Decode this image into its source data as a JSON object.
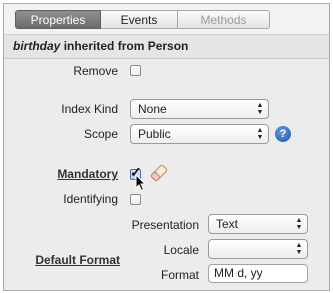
{
  "tabs": [
    {
      "label": "Properties",
      "state": "active"
    },
    {
      "label": "Events",
      "state": "normal"
    },
    {
      "label": "Methods",
      "state": "disabled"
    }
  ],
  "header": {
    "name": "birthday",
    "suffix": "inherited from Person"
  },
  "fields": {
    "remove": {
      "label": "Remove",
      "checked": false
    },
    "index_kind": {
      "label": "Index Kind",
      "value": "None"
    },
    "scope": {
      "label": "Scope",
      "value": "Public"
    },
    "mandatory": {
      "label": "Mandatory",
      "checked": true
    },
    "identifying": {
      "label": "Identifying",
      "checked": false
    },
    "default_format": {
      "label": "Default Format"
    },
    "presentation": {
      "label": "Presentation",
      "value": "Text"
    },
    "locale": {
      "label": "Locale",
      "value": ""
    },
    "format": {
      "label": "Format",
      "value": "MM d, yy"
    }
  },
  "icons": {
    "help": "help-icon",
    "eraser": "eraser-icon",
    "cursor": "pointer-cursor"
  },
  "help_glyph": "?",
  "colors": {
    "active_tab": "#7a7a7a",
    "help_blue": "#2a63b5"
  }
}
